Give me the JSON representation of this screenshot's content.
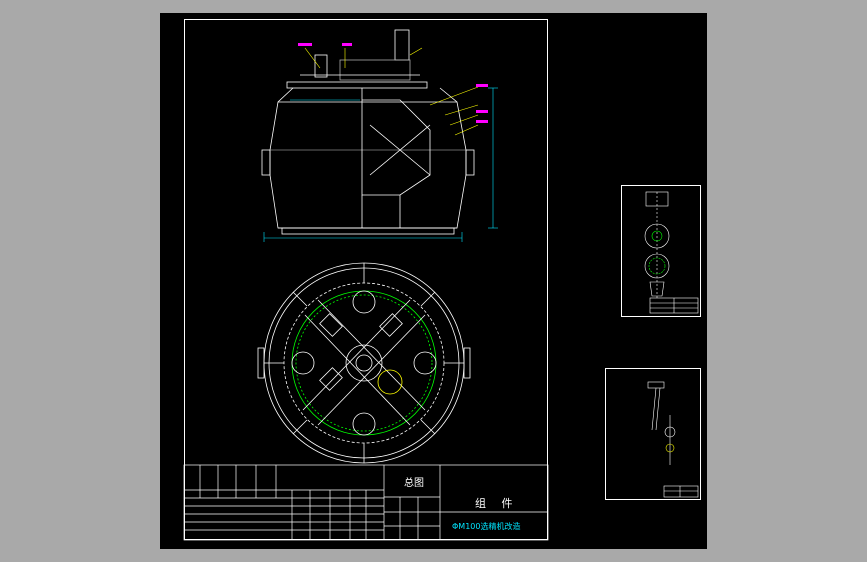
{
  "drawing": {
    "title_block": {
      "drawing_name": "总图",
      "category": "组 件",
      "project_name": "ΦM100选精机改造"
    },
    "colors": {
      "canvas_background": "#000000",
      "app_background": "#a9a9a9",
      "outline": "#ffffff",
      "geometry": "#00ff00",
      "dimension": "#00e5ff",
      "leader": "#ffff00",
      "annotation": "#ff00ff"
    }
  }
}
